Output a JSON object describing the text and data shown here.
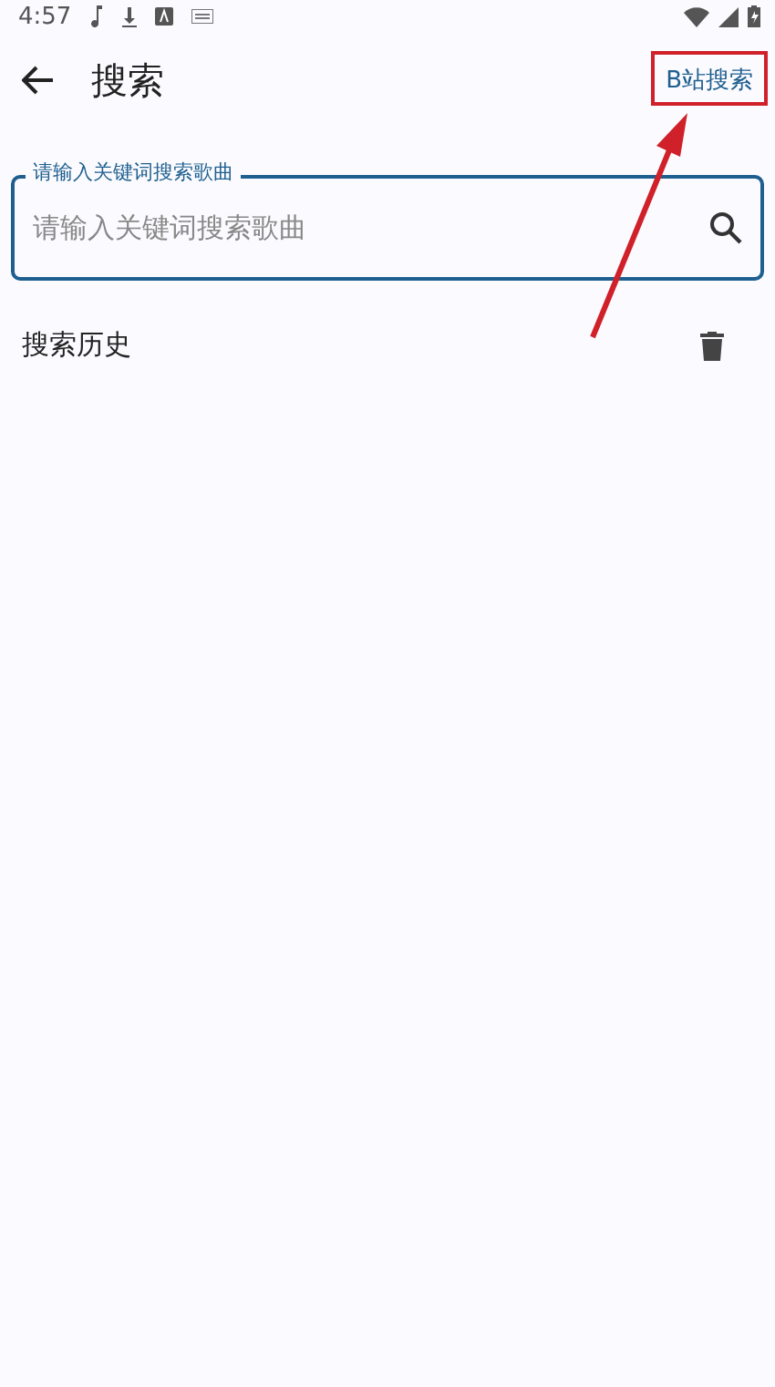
{
  "status_bar": {
    "time": "4:57"
  },
  "header": {
    "title": "搜索",
    "action": "B站搜索"
  },
  "search": {
    "label": "请输入关键词搜索歌曲",
    "placeholder": "请输入关键词搜索歌曲"
  },
  "history": {
    "title": "搜索历史"
  },
  "annotation": {
    "kind": "highlight-arrow"
  }
}
